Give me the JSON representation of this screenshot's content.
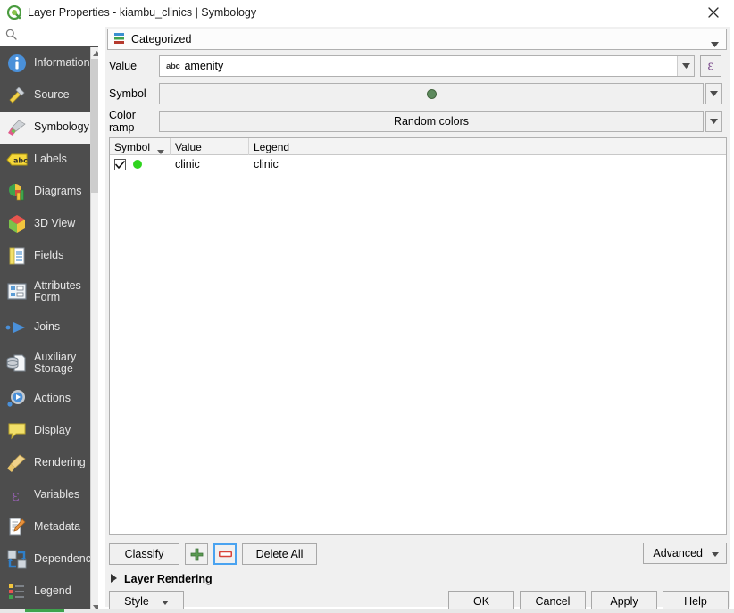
{
  "window": {
    "title": "Layer Properties - kiambu_clinics | Symbology",
    "app_icon": "qgis-logo-icon",
    "close_label": "✕"
  },
  "sidebar": {
    "search": {
      "value": "",
      "placeholder": "",
      "icon": "search-icon"
    },
    "items": [
      {
        "label": "Information",
        "icon": "information-icon",
        "selected": false
      },
      {
        "label": "Source",
        "icon": "source-icon",
        "selected": false
      },
      {
        "label": "Symbology",
        "icon": "symbology-brush-icon",
        "selected": true
      },
      {
        "label": "Labels",
        "icon": "labels-abc-icon",
        "selected": false
      },
      {
        "label": "Diagrams",
        "icon": "diagrams-chart-icon",
        "selected": false
      },
      {
        "label": "3D View",
        "icon": "cube-3d-icon",
        "selected": false
      },
      {
        "label": "Fields",
        "icon": "fields-table-icon",
        "selected": false
      },
      {
        "label": "Attributes\nForm",
        "icon": "attributes-form-icon",
        "selected": false
      },
      {
        "label": "Joins",
        "icon": "joins-icon",
        "selected": false
      },
      {
        "label": "Auxiliary\nStorage",
        "icon": "auxiliary-storage-icon",
        "selected": false
      },
      {
        "label": "Actions",
        "icon": "actions-gear-icon",
        "selected": false
      },
      {
        "label": "Display",
        "icon": "display-balloon-icon",
        "selected": false
      },
      {
        "label": "Rendering",
        "icon": "rendering-brush-icon",
        "selected": false
      },
      {
        "label": "Variables",
        "icon": "variables-epsilon-icon",
        "selected": false
      },
      {
        "label": "Metadata",
        "icon": "metadata-pencil-icon",
        "selected": false
      },
      {
        "label": "Dependencies",
        "icon": "dependencies-icon",
        "selected": false
      },
      {
        "label": "Legend",
        "icon": "legend-icon",
        "selected": false
      }
    ]
  },
  "symbology": {
    "renderer": {
      "label": "Categorized",
      "icon": "categorized-icon"
    },
    "value_row": {
      "label": "Value",
      "field_badge": "abc",
      "field_value": "amenity",
      "expression_button": "ε"
    },
    "symbol_row": {
      "label": "Symbol",
      "preview": "green-point-symbol"
    },
    "colorramp_row": {
      "label": "Color ramp",
      "value": "Random colors"
    },
    "table": {
      "columns": [
        "Symbol",
        "Value",
        "Legend"
      ],
      "rows": [
        {
          "checked": true,
          "symbol": "green-point-symbol",
          "value": "clinic",
          "legend": "clinic"
        }
      ]
    }
  },
  "toolbar": {
    "classify_label": "Classify",
    "add_icon": "plus-icon",
    "remove_icon": "minus-icon",
    "delete_all_label": "Delete All",
    "advanced_label": "Advanced"
  },
  "layer_rendering": {
    "label": "Layer Rendering",
    "expanded": false,
    "icon": "chevron-right-icon"
  },
  "footer": {
    "style_label": "Style",
    "ok_label": "OK",
    "cancel_label": "Cancel",
    "apply_label": "Apply",
    "help_label": "Help"
  },
  "colors": {
    "sidebar_bg": "#4d4d4d",
    "selected_bg": "#f2f2f2",
    "panel_bg": "#f0f0f0",
    "bright_green": "#2fd41e",
    "muted_green": "#5d8a5d",
    "focus_blue": "#4aa3f0",
    "epsilon_purple": "#7a4a8c"
  }
}
